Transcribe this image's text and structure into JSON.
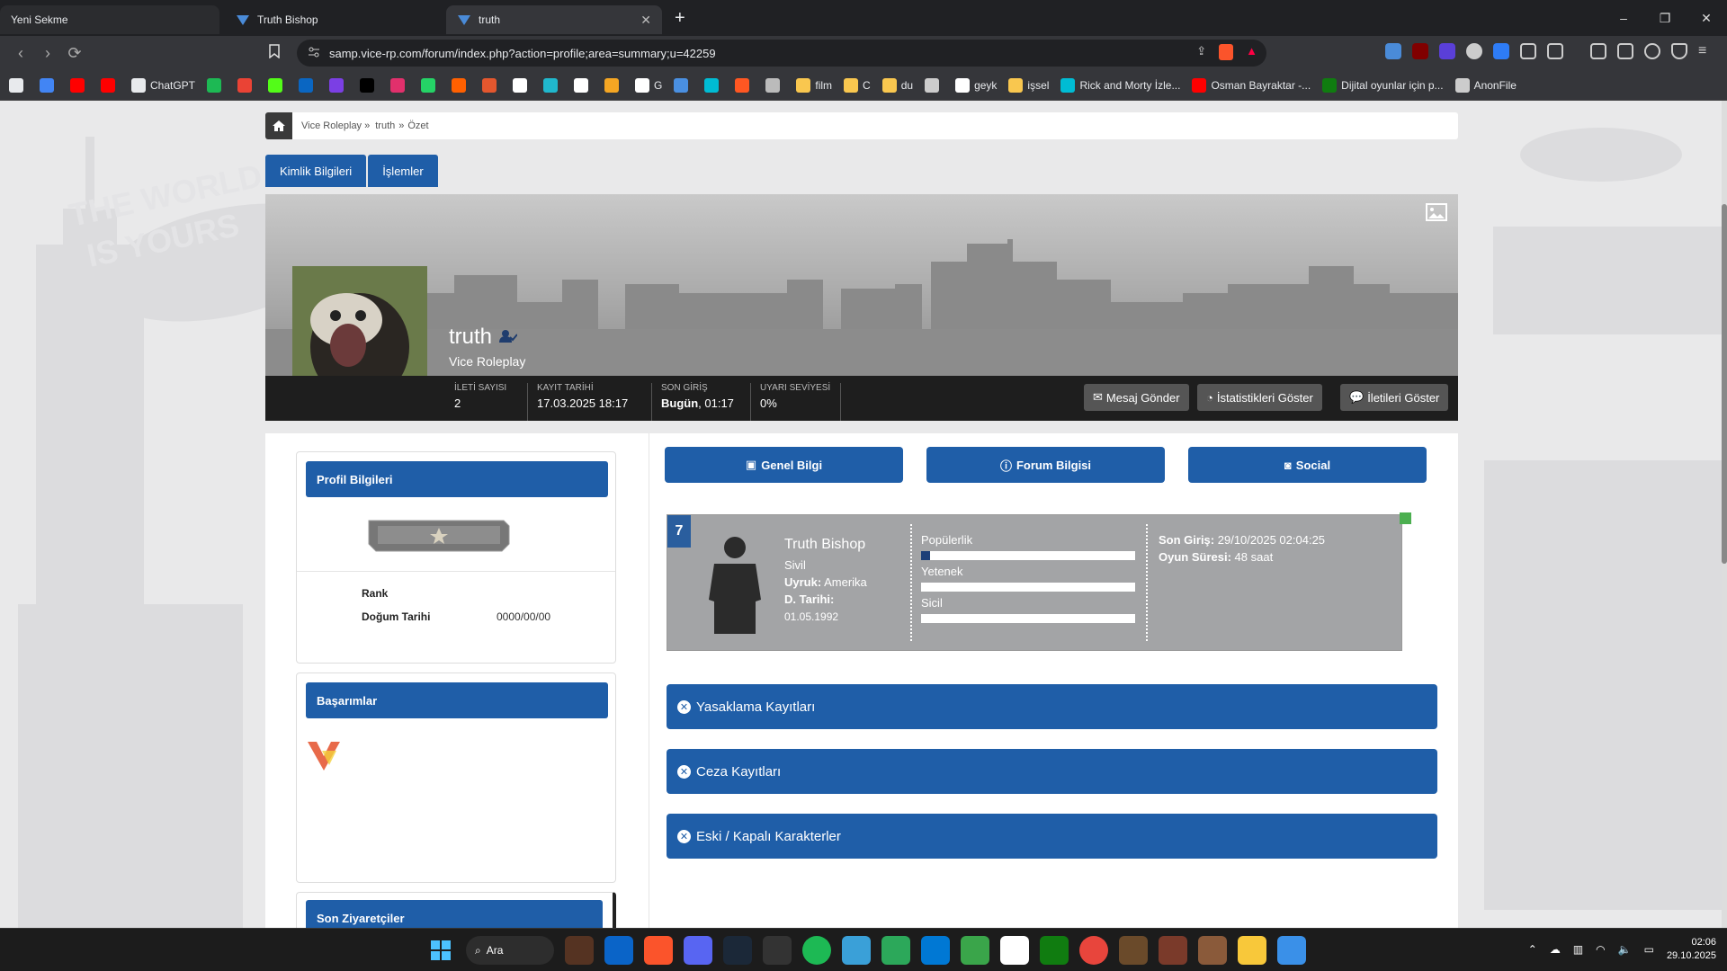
{
  "browser": {
    "tabs": [
      {
        "title": "Yeni Sekme",
        "active": false
      },
      {
        "title": "Truth Bishop",
        "active": false
      },
      {
        "title": "truth",
        "active": true
      }
    ],
    "new_tab": "+",
    "url": "samp.vice-rp.com/forum/index.php?action=profile;area=summary;u=42259",
    "window_controls": [
      "–",
      "❐",
      "✕"
    ]
  },
  "bookmarks": [
    {
      "label": "",
      "icon": "apps-icon",
      "color": "#e8eaed"
    },
    {
      "label": "",
      "icon": "google-icon",
      "color": "#4285f4"
    },
    {
      "label": "",
      "icon": "youtube-icon",
      "color": "#ff0000"
    },
    {
      "label": "",
      "icon": "youtube-music-icon",
      "color": "#ff0000"
    },
    {
      "label": "ChatGPT",
      "icon": "chatgpt-icon",
      "color": "#e8eaed"
    },
    {
      "label": "",
      "icon": "spotify-icon",
      "color": "#1db954"
    },
    {
      "label": "",
      "icon": "gmail-icon",
      "color": "#ea4335"
    },
    {
      "label": "",
      "icon": "kick-icon",
      "color": "#53fc18"
    },
    {
      "label": "",
      "icon": "linkedin-icon",
      "color": "#0a66c2"
    },
    {
      "label": "",
      "icon": "kimi-icon",
      "color": "#7b3fe4"
    },
    {
      "label": "",
      "icon": "x-icon",
      "color": "#000000"
    },
    {
      "label": "",
      "icon": "instagram-icon",
      "color": "#e1306c"
    },
    {
      "label": "",
      "icon": "whatsapp-icon",
      "color": "#25d366"
    },
    {
      "label": "",
      "icon": "hb-icon",
      "color": "#ff6000"
    },
    {
      "label": "",
      "icon": "r10-icon",
      "color": "#e4572e"
    },
    {
      "label": "",
      "icon": "amazon-icon",
      "color": "#ffffff"
    },
    {
      "label": "",
      "icon": "perplexity-icon",
      "color": "#20b8cd"
    },
    {
      "label": "",
      "icon": "b-icon",
      "color": "#ffffff"
    },
    {
      "label": "",
      "icon": "arrow-icon",
      "color": "#f5a623"
    },
    {
      "label": "G",
      "icon": "github-icon",
      "color": "#ffffff"
    },
    {
      "label": "",
      "icon": "pen-icon",
      "color": "#4a90e2"
    },
    {
      "label": "",
      "icon": "v-icon",
      "color": "#00bcd4"
    },
    {
      "label": "",
      "icon": "puzzle-icon",
      "color": "#ff5722"
    },
    {
      "label": "",
      "icon": "globe-icon",
      "color": "#bbbbbb"
    },
    {
      "label": "film",
      "icon": "folder-icon",
      "color": "#f9c74f"
    },
    {
      "label": "C",
      "icon": "folder-icon",
      "color": "#f9c74f"
    },
    {
      "label": "du",
      "icon": "folder-icon",
      "color": "#f9c74f"
    },
    {
      "label": "",
      "icon": "crown-icon",
      "color": "#cccccc"
    },
    {
      "label": "geyk",
      "icon": "amazon-icon",
      "color": "#ffffff"
    },
    {
      "label": "işsel",
      "icon": "folder-icon",
      "color": "#f9c74f"
    },
    {
      "label": "Rick and Morty İzle...",
      "icon": "v-icon",
      "color": "#00bcd4"
    },
    {
      "label": "Osman Bayraktar -...",
      "icon": "youtube-icon",
      "color": "#ff0000"
    },
    {
      "label": "Dijital oyunlar için p...",
      "icon": "xbox-icon",
      "color": "#107c10"
    },
    {
      "label": "AnonFile",
      "icon": "anon-icon",
      "color": "#cccccc"
    }
  ],
  "breadcrumb": {
    "items": [
      "Vice Roleplay »",
      "truth",
      "»",
      "Özet"
    ]
  },
  "profile_tabs": [
    "Kimlik Bilgileri",
    "İşlemler"
  ],
  "profile": {
    "username": "truth",
    "group": "Vice Roleplay",
    "stats": [
      {
        "label": "İLETİ SAYISI",
        "value": "2"
      },
      {
        "label": "KAYIT TARİHİ",
        "value": "17.03.2025 18:17"
      },
      {
        "label": "SON GİRİŞ",
        "value_bold": "Bugün",
        "value": ", 01:17"
      },
      {
        "label": "UYARI SEVİYESİ",
        "value": "0%"
      }
    ],
    "actions": [
      "Mesaj Gönder",
      "İstatistikleri Göster",
      "İletileri Göster"
    ]
  },
  "left": {
    "profile_box_title": "Profil Bilgileri",
    "fields": [
      {
        "label": "Rank",
        "value": ""
      },
      {
        "label": "Doğum Tarihi",
        "value": "0000/00/00"
      }
    ],
    "achievements_title": "Başarımlar",
    "visitors_title": "Son Ziyaretçiler"
  },
  "right": {
    "top_buttons": [
      {
        "label": "Genel Bilgi",
        "icon": "id-card-icon"
      },
      {
        "label": "Forum Bilgisi",
        "icon": "info-icon"
      },
      {
        "label": "Social",
        "icon": "camera-icon"
      }
    ],
    "character": {
      "level": "7",
      "name": "Truth Bishop",
      "status": "Sivil",
      "nationality_label": "Uyruk:",
      "nationality": "Amerika",
      "birth_label": "D. Tarihi:",
      "birth": "01.05.1992",
      "bars": [
        {
          "label": "Popülerlik",
          "value": 4
        },
        {
          "label": "Yetenek",
          "value": 0
        },
        {
          "label": "Sicil",
          "value": 0
        }
      ],
      "last_login_label": "Son Giriş:",
      "last_login": "29/10/2025 02:04:25",
      "playtime_label": "Oyun Süresi:",
      "playtime": "48 saat"
    },
    "accordions": [
      "Yasaklama Kayıtları",
      "Ceza Kayıtları",
      "Eski / Kapalı Karakterler"
    ]
  },
  "taskbar": {
    "search": "Ara",
    "time": "02:06",
    "date": "29.10.2025"
  }
}
